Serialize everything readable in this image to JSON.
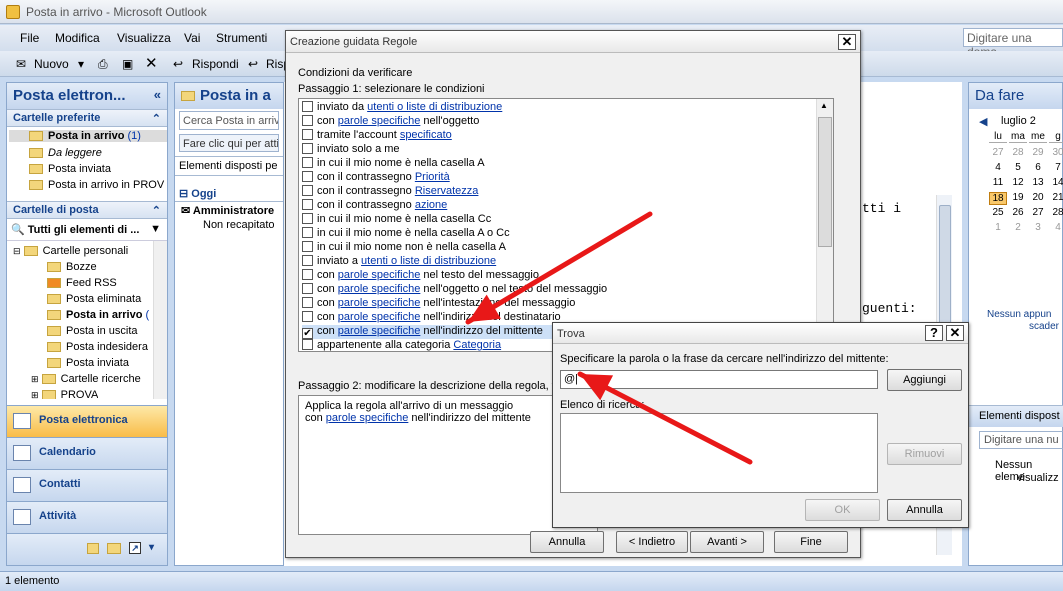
{
  "window": {
    "title": "Posta in arrivo - Microsoft Outlook"
  },
  "menu": [
    "File",
    "Modifica",
    "Visualizza",
    "Vai",
    "Strumenti"
  ],
  "help_placeholder": "Digitare una doma",
  "toolbar": {
    "new": "Nuovo",
    "reply": "Rispondi",
    "reply2": "Risp"
  },
  "nav": {
    "title": "Posta elettron...",
    "favorites_header": "Cartelle preferite",
    "favorites": [
      {
        "label": "Posta in arrivo",
        "count": "(1)"
      },
      {
        "label": "Da leggere"
      },
      {
        "label": "Posta inviata"
      },
      {
        "label": "Posta in arrivo in PROV"
      }
    ],
    "mail_header": "Cartelle di posta",
    "all_items": "Tutti gli elementi di ...",
    "tree": [
      "Cartelle personali",
      "Bozze",
      "Feed RSS",
      "Posta eliminata",
      "Posta in arrivo",
      "Posta in uscita",
      "Posta indesidera",
      "Posta inviata",
      "Cartelle ricerche",
      "PROVA"
    ],
    "tree_inbox_count": "(",
    "buttons": [
      "Posta elettronica",
      "Calendario",
      "Contatti",
      "Attività"
    ]
  },
  "inbox": {
    "title": "Posta in a",
    "search": "Cerca Posta in arrivo",
    "click_hint": "Fare clic qui per atti",
    "arranged": "Elementi disposti pe",
    "group": "Oggi",
    "sender": "Amministratore",
    "subject": "Non recapitato"
  },
  "reading": {
    "line1": "tti i",
    "line2": "guenti:"
  },
  "todo": {
    "title": "Da fare",
    "month": "luglio 2",
    "days": [
      "lu",
      "ma",
      "me",
      "g"
    ],
    "weeks": [
      [
        "27",
        "28",
        "29",
        "30"
      ],
      [
        "4",
        "5",
        "6",
        "7"
      ],
      [
        "11",
        "12",
        "13",
        "14"
      ],
      [
        "18",
        "19",
        "20",
        "21"
      ],
      [
        "25",
        "26",
        "27",
        "28"
      ],
      [
        "1",
        "2",
        "3",
        "4"
      ]
    ],
    "no_appointments": [
      "Nessun appun",
      "scader"
    ],
    "tasks_header": "Elementi dispost",
    "task_input": "Digitare una nu",
    "no_items": [
      "Nessun eleme",
      "visualizz"
    ]
  },
  "status": "1 elemento",
  "wizard": {
    "title": "Creazione guidata Regole",
    "section": "Condizioni da verificare",
    "step1": "Passaggio 1: selezionare le condizioni",
    "conditions": [
      {
        "pre": "inviato da ",
        "link": "utenti o liste di distribuzione",
        "post": ""
      },
      {
        "pre": "con ",
        "link": "parole specifiche",
        "post": " nell'oggetto"
      },
      {
        "pre": "tramite l'account ",
        "link": "specificato",
        "post": ""
      },
      {
        "pre": "inviato solo a me",
        "link": "",
        "post": ""
      },
      {
        "pre": "in cui il mio nome è nella casella A",
        "link": "",
        "post": ""
      },
      {
        "pre": "con il contrassegno ",
        "link": "Priorità",
        "post": ""
      },
      {
        "pre": "con il contrassegno ",
        "link": "Riservatezza",
        "post": ""
      },
      {
        "pre": "con il contrassegno ",
        "link": "azione",
        "post": ""
      },
      {
        "pre": "in cui il mio nome è nella casella Cc",
        "link": "",
        "post": ""
      },
      {
        "pre": "in cui il mio nome è nella casella A o Cc",
        "link": "",
        "post": ""
      },
      {
        "pre": "in cui il mio nome non è nella casella A",
        "link": "",
        "post": ""
      },
      {
        "pre": "inviato a ",
        "link": "utenti o liste di distribuzione",
        "post": ""
      },
      {
        "pre": "con ",
        "link": "parole specifiche",
        "post": " nel testo del messaggio"
      },
      {
        "pre": "con ",
        "link": "parole specifiche",
        "post": " nell'oggetto o nel testo del messaggio"
      },
      {
        "pre": "con ",
        "link": "parole specifiche",
        "post": " nell'intestazione del messaggio"
      },
      {
        "pre": "con ",
        "link": "parole specifiche",
        "post": " nell'indirizzo del destinatario"
      },
      {
        "pre": "con ",
        "link": "parole specifiche",
        "post": " nell'indirizzo del mittente",
        "checked": true,
        "selected": true
      },
      {
        "pre": "appartenente alla categoria ",
        "link": "Categoria",
        "post": ""
      }
    ],
    "step2": "Passaggio 2: modificare la descrizione della regola, fa",
    "desc_line1": "Applica la regola all'arrivo di un messaggio",
    "desc_pre": "con ",
    "desc_link": "parole specifiche",
    "desc_post": " nell'indirizzo del mittente",
    "buttons": {
      "cancel": "Annulla",
      "back": "< Indietro",
      "next": "Avanti >",
      "finish": "Fine"
    }
  },
  "trova": {
    "title": "Trova",
    "help": "?",
    "close": "✕",
    "prompt": "Specificare la parola o la frase da cercare nell'indirizzo del mittente:",
    "value": "@|",
    "add": "Aggiungi",
    "list_label": "Elenco di ricerca:",
    "remove": "Rimuovi",
    "ok": "OK",
    "cancel": "Annulla"
  },
  "annotation": {
    "arrow_color": "#e81818"
  }
}
